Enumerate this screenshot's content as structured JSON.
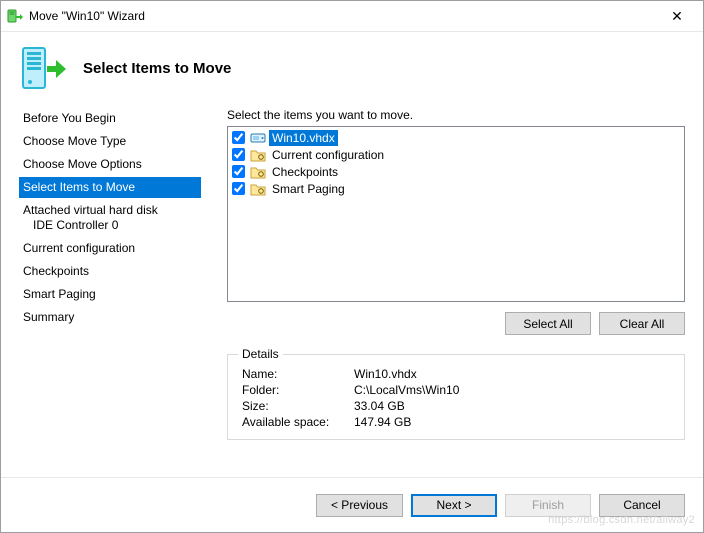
{
  "window": {
    "title": "Move \"Win10\" Wizard"
  },
  "header": {
    "title": "Select Items to Move"
  },
  "sidebar": {
    "items": [
      {
        "label": "Before You Begin"
      },
      {
        "label": "Choose Move Type"
      },
      {
        "label": "Choose Move Options"
      },
      {
        "label": "Select Items to Move"
      },
      {
        "label": "Attached virtual hard disk"
      },
      {
        "label": "IDE Controller 0"
      },
      {
        "label": "Current configuration"
      },
      {
        "label": "Checkpoints"
      },
      {
        "label": "Smart Paging"
      },
      {
        "label": "Summary"
      }
    ],
    "active_index": 3
  },
  "content": {
    "instruction": "Select the items you want to move.",
    "items": [
      {
        "label": "Win10.vhdx",
        "checked": true,
        "selected": true,
        "icon": "disk-icon"
      },
      {
        "label": "Current configuration",
        "checked": true,
        "selected": false,
        "icon": "folder-gear-icon"
      },
      {
        "label": "Checkpoints",
        "checked": true,
        "selected": false,
        "icon": "folder-gear-icon"
      },
      {
        "label": "Smart Paging",
        "checked": true,
        "selected": false,
        "icon": "folder-gear-icon"
      }
    ],
    "buttons": {
      "select_all": "Select All",
      "clear_all": "Clear All"
    },
    "details": {
      "legend": "Details",
      "name_label": "Name:",
      "name_value": "Win10.vhdx",
      "folder_label": "Folder:",
      "folder_value": "C:\\LocalVms\\Win10",
      "size_label": "Size:",
      "size_value": "33.04 GB",
      "avail_label": "Available space:",
      "avail_value": "147.94 GB"
    }
  },
  "footer": {
    "previous": "< Previous",
    "next": "Next >",
    "finish": "Finish",
    "cancel": "Cancel"
  },
  "watermark": "https://blog.csdn.net/allway2"
}
